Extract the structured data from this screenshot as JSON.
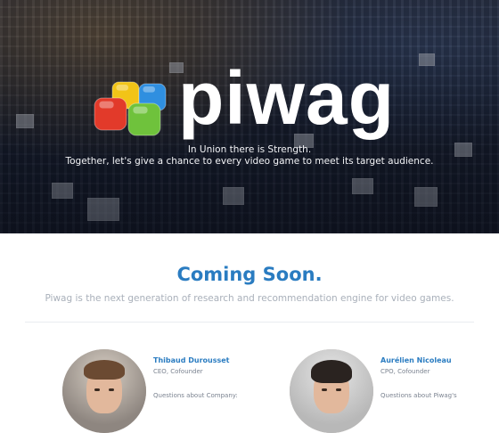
{
  "hero": {
    "brand": "piwag",
    "tagline_1": "In Union there is Strength.",
    "tagline_2": "Together, let's give a chance to every video game to meet its target audience."
  },
  "main": {
    "heading": "Coming Soon.",
    "subheading": "Piwag is the next generation of research and recommendation engine for video games."
  },
  "team": [
    {
      "name": "Thibaud Durousset",
      "role": "CEO, Cofounder",
      "question": "Questions about Company:"
    },
    {
      "name": "Aurélien Nicoleau",
      "role": "CPO, Cofounder",
      "question": "Questions about Piwag's"
    }
  ],
  "colors": {
    "accent": "#2a7cc1",
    "cube_yellow": "#f2c417",
    "cube_blue": "#2f8fe0",
    "cube_red": "#e23a2a",
    "cube_green": "#6fc23c"
  }
}
